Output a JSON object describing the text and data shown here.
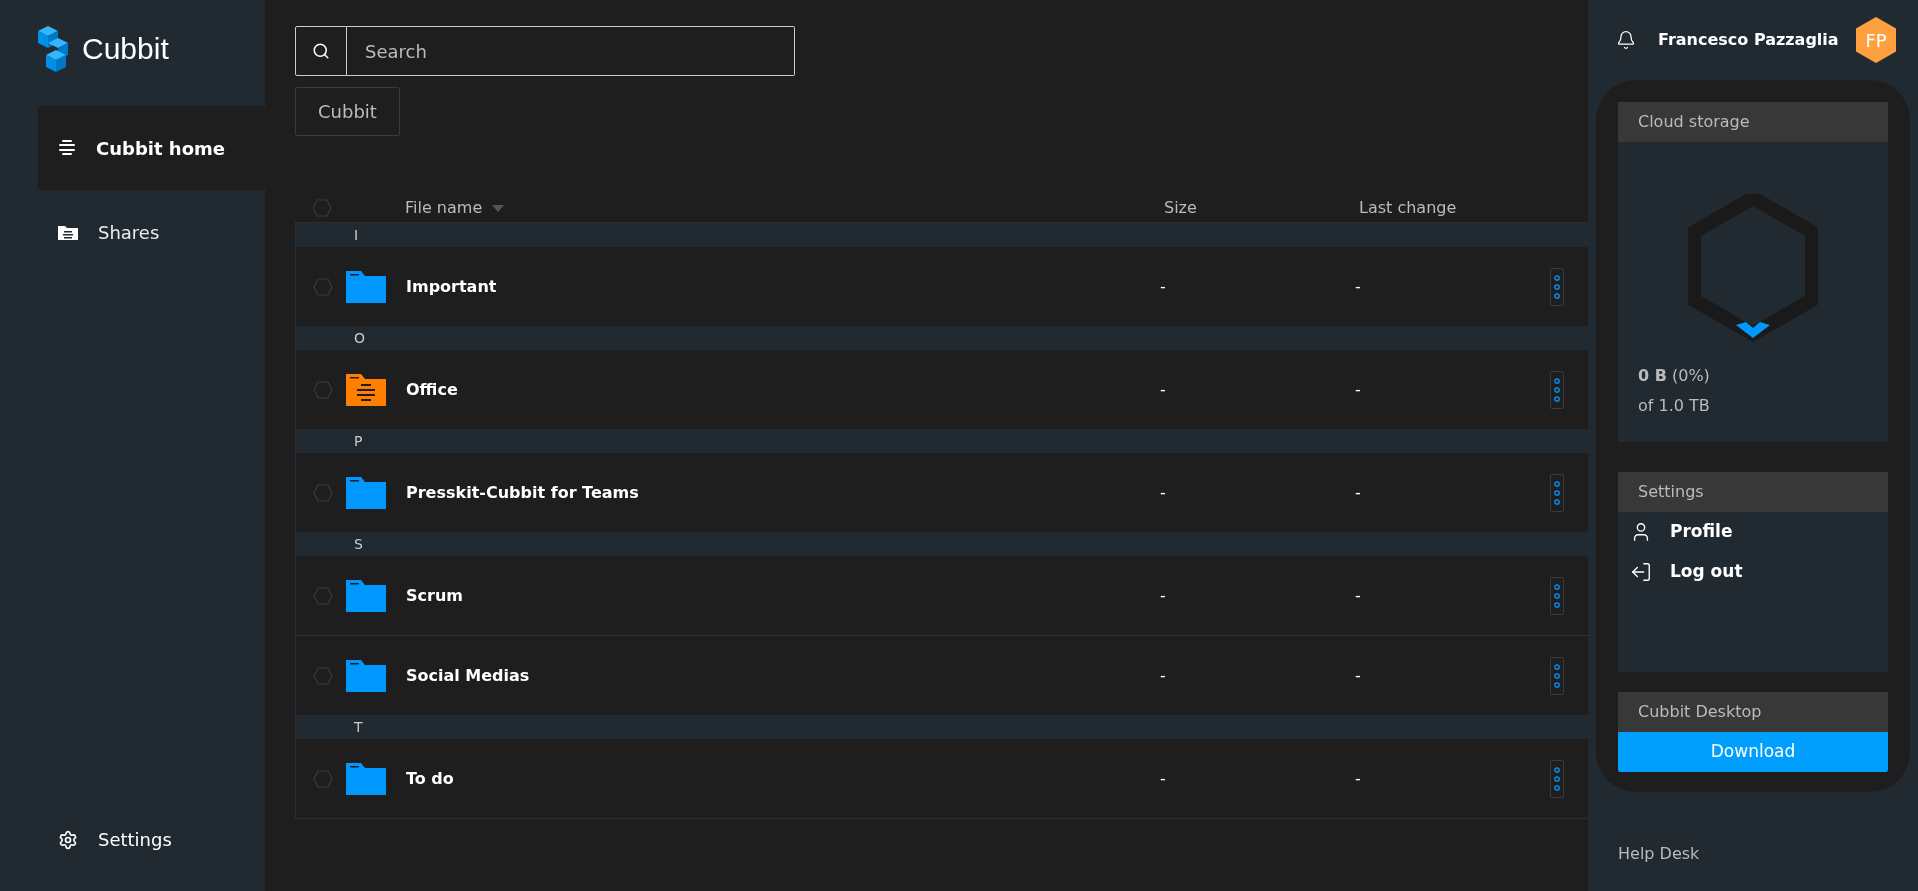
{
  "sidebar": {
    "logo_text": "Cubbit",
    "items": [
      {
        "label": "Cubbit home",
        "kind": "home",
        "selected": true
      },
      {
        "label": "Shares",
        "kind": "shares",
        "selected": false
      }
    ],
    "footer_item": {
      "label": "Settings"
    }
  },
  "search": {
    "placeholder": "Search"
  },
  "breadcrumb": [
    "Cubbit"
  ],
  "table": {
    "select_all_checked": false,
    "columns": [
      {
        "label": "File name",
        "sorted": true
      },
      {
        "label": "Size",
        "sorted": false
      },
      {
        "label": "Last change",
        "sorted": false
      }
    ],
    "groups": [
      {
        "letter": "I",
        "rows": [
          {
            "name": "Important",
            "kind": "folder",
            "size": "-",
            "last_change": "-",
            "checked": false
          }
        ]
      },
      {
        "letter": "O",
        "rows": [
          {
            "name": "Office",
            "kind": "shared-folder",
            "size": "-",
            "last_change": "-",
            "checked": false
          }
        ]
      },
      {
        "letter": "P",
        "rows": [
          {
            "name": "Presskit-Cubbit for Teams",
            "kind": "folder",
            "size": "-",
            "last_change": "-",
            "checked": false
          }
        ]
      },
      {
        "letter": "S",
        "rows": [
          {
            "name": "Scrum",
            "kind": "folder",
            "size": "-",
            "last_change": "-",
            "checked": false
          },
          {
            "name": "Social Medias",
            "kind": "folder",
            "size": "-",
            "last_change": "-",
            "checked": false
          }
        ]
      },
      {
        "letter": "T",
        "rows": [
          {
            "name": "To do",
            "kind": "folder",
            "size": "-",
            "last_change": "-",
            "checked": false
          }
        ]
      }
    ]
  },
  "user": {
    "name": "Francesco Pazzaglia",
    "initials": "FP"
  },
  "cloud_storage": {
    "title": "Cloud storage",
    "used": "**0 B** (0%)",
    "total": "of 1.0 TB"
  },
  "settings_card": {
    "title": "Settings",
    "items": [
      {
        "label": "Profile",
        "kind": "profile"
      },
      {
        "label": "Log out",
        "kind": "logout"
      }
    ]
  },
  "desktop_card": {
    "title": "Cubbit Desktop",
    "button": "Download"
  },
  "help": "Help Desk"
}
